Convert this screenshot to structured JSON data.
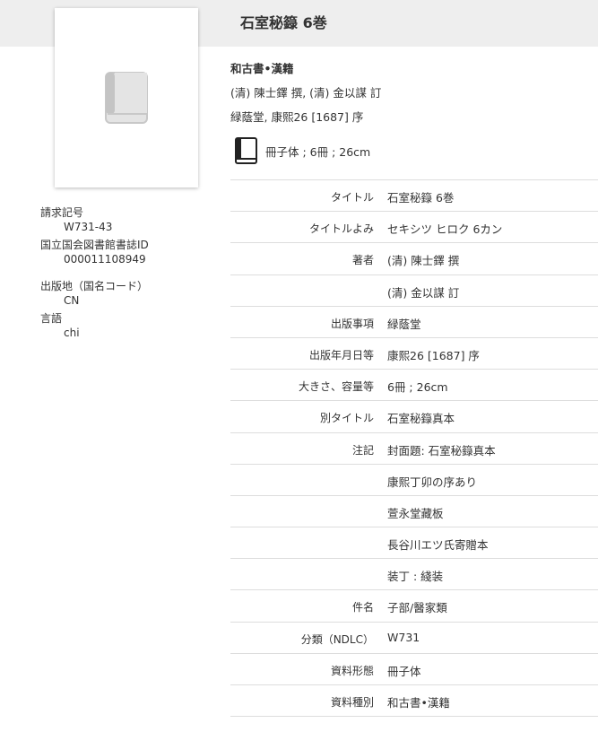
{
  "title": "石室秘籙 6巻",
  "summary": {
    "type": "和古書•漢籍",
    "authors": "(清) 陳士鐸 撰, (清) 金以謀 訂",
    "publisher": "緑蔭堂, 康熙26 [1687] 序",
    "format": "冊子体 ; 6冊 ; 26cm"
  },
  "identifiers": [
    {
      "label": "請求記号",
      "value": "W731-43"
    },
    {
      "label": "国立国会図書館書誌ID",
      "value": "000011108949"
    },
    {
      "label": "出版地（国名コード）",
      "value": "CN"
    },
    {
      "label": "言語",
      "value": "chi"
    }
  ],
  "details": [
    {
      "key": "タイトル",
      "value": "石室秘籙 6巻"
    },
    {
      "key": "タイトルよみ",
      "value": "セキシツ ヒロク 6カン"
    },
    {
      "key": "著者",
      "value": "(清) 陳士鐸 撰"
    },
    {
      "key": "",
      "value": "(清) 金以謀 訂"
    },
    {
      "key": "出版事項",
      "value": "緑蔭堂"
    },
    {
      "key": "出版年月日等",
      "value": "康熙26 [1687] 序"
    },
    {
      "key": "大きさ、容量等",
      "value": "6冊 ; 26cm"
    },
    {
      "key": "別タイトル",
      "value": "石室秘籙真本"
    },
    {
      "key": "注記",
      "value": "封面題: 石室秘籙真本"
    },
    {
      "key": "",
      "value": "康熙丁卯の序あり"
    },
    {
      "key": "",
      "value": "萱永堂藏板"
    },
    {
      "key": "",
      "value": "長谷川エツ氏寄贈本"
    },
    {
      "key": "",
      "value": "装丁 : 綫装"
    },
    {
      "key": "件名",
      "value": "子部/醫家類"
    },
    {
      "key": "分類（NDLC）",
      "value": "W731"
    },
    {
      "key": "資料形態",
      "value": "冊子体"
    },
    {
      "key": "資料種別",
      "value": "和古書•漢籍"
    }
  ]
}
